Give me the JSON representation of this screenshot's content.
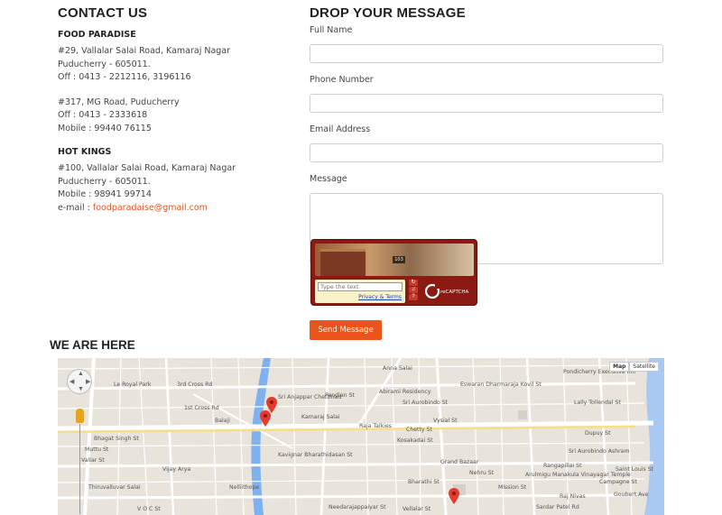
{
  "contact": {
    "title_light": "CONTACT ",
    "title_bold": "US",
    "businesses": [
      {
        "name": "FOOD PARADISE",
        "addresses": [
          [
            "#29, Vallalar Salai Road, Kamaraj Nagar",
            "Puducherry - 605011.",
            "Off : 0413 - 2212116, 3196116"
          ],
          [
            "#317, MG Road, Puducherry",
            "Off : 0413 - 2333618",
            "Mobile : 99440 76115"
          ]
        ]
      },
      {
        "name": "HOT KINGS",
        "addresses": [
          [
            "#100, Vallalar Salai Road, Kamaraj Nagar",
            "Puducherry - 605011.",
            "Mobile : 98941 99714"
          ]
        ]
      }
    ],
    "email_label": "e-mail : ",
    "email": "foodparadaise@gmail.com"
  },
  "form": {
    "title_light": "DROP YOUR ",
    "title_bold": "MESSAGE",
    "full_name_label": "Full Name",
    "phone_label": "Phone Number",
    "email_label": "Email Address",
    "message_label": "Message",
    "captcha": {
      "placeholder": "Type the text",
      "privacy": "Privacy & Terms",
      "image_number": "103",
      "logo_text": "reCAPTCHA"
    },
    "send_label": "Send Message"
  },
  "map_section": {
    "title_light": "WE ARE ",
    "title_bold": "HERE",
    "map_type": [
      "Map",
      "Satellite"
    ],
    "active_type": "Map",
    "labels": [
      "Le Royal Park",
      "3rd Cross Rd",
      "1st Cross Rd",
      "Balaji",
      "Bhagat Singh St",
      "Muttu St",
      "Vallar St",
      "Vijay Arya",
      "Thiruvalluvar Salai",
      "V O C St",
      "Kamaraj Salai",
      "Sri Anjappar Chettinad",
      "Pandian St",
      "Raja Talkies",
      "Abirami Residency",
      "Eswaran Dharmaraja Kovil St",
      "Sri Aurobindo St",
      "Vysial St",
      "Chetty St",
      "Kosakadai St",
      "Grand Bazaar",
      "Nehru St",
      "Bharathi St",
      "Mission St",
      "Arulmigu Manakula Vinayagar Temple",
      "Pondicherry Executive Inn",
      "Lally Tollendal St",
      "Dupuy St",
      "Sri Aurobindo Ashram",
      "Rangapillai St",
      "Raj Nivas",
      "Vellalar St",
      "Needarajappaiyar St",
      "Saint Louis St",
      "Campagne St",
      "Goubert Ave",
      "Anna Salai",
      "Sardar Patel Rd",
      "Nelliithope",
      "Kavignar Bharathidasan St"
    ]
  },
  "colors": {
    "accent": "#e8541c",
    "captcha_red": "#8a1a12",
    "map_bg": "#e8e4dc",
    "canal": "#7fb0f0"
  }
}
